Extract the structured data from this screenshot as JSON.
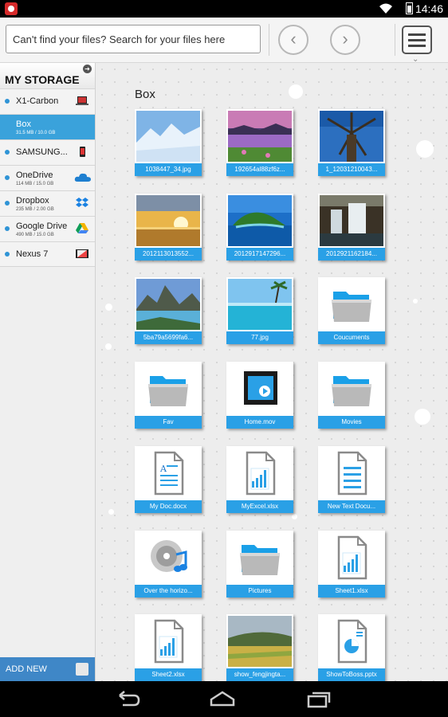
{
  "status": {
    "time": "14:46"
  },
  "search": {
    "placeholder": "Can't find your files? Search for your files here"
  },
  "toolbar": {
    "prev": "‹",
    "next": "›"
  },
  "sidebar": {
    "title": "MY STORAGE",
    "items": [
      {
        "label": "X1-Carbon",
        "sub": "",
        "icon": "laptop-icon"
      },
      {
        "label": "Box",
        "sub": "31.5 MB / 10.0 GB",
        "icon": "",
        "active": true
      },
      {
        "label": "SAMSUNG...",
        "sub": "",
        "icon": "phone-icon"
      },
      {
        "label": "OneDrive",
        "sub": "114 MB / 15.0 GB",
        "icon": "cloud-icon"
      },
      {
        "label": "Dropbox",
        "sub": "235 MB / 2.00 GB",
        "icon": "dropbox-icon"
      },
      {
        "label": "Google Drive",
        "sub": "490 MB / 15.0 GB",
        "icon": "google-drive-icon"
      },
      {
        "label": "Nexus 7",
        "sub": "",
        "icon": "tablet-icon"
      }
    ],
    "add_new": "ADD NEW"
  },
  "breadcrumb": "Box",
  "files": [
    {
      "name": "1038447_34.jpg",
      "kind": "photo-snow-mountain"
    },
    {
      "name": "192654al88zf6z...",
      "kind": "photo-pink-lake"
    },
    {
      "name": "1_1203121004З...",
      "kind": "photo-windmill"
    },
    {
      "name": "2012113013552...",
      "kind": "photo-sunset-sea"
    },
    {
      "name": "2012917147296...",
      "kind": "photo-tropical-island"
    },
    {
      "name": "2012921162184...",
      "kind": "photo-waterfall"
    },
    {
      "name": "5ba79a5699fa6...",
      "kind": "photo-mountain-lake"
    },
    {
      "name": "77.jpg",
      "kind": "photo-beach"
    },
    {
      "name": "Coucuments",
      "kind": "folder"
    },
    {
      "name": "Fav",
      "kind": "folder"
    },
    {
      "name": "Home.mov",
      "kind": "video"
    },
    {
      "name": "Movies",
      "kind": "folder"
    },
    {
      "name": "My Doc.docx",
      "kind": "doc"
    },
    {
      "name": "MyExcel.xlsx",
      "kind": "xls"
    },
    {
      "name": "New Text Docu...",
      "kind": "txt"
    },
    {
      "name": "Over the horizo...",
      "kind": "music"
    },
    {
      "name": "Pictures",
      "kind": "folder"
    },
    {
      "name": "Sheet1.xlsx",
      "kind": "xls"
    },
    {
      "name": "Sheet2.xlsx",
      "kind": "xls"
    },
    {
      "name": "show_fengjingta...",
      "kind": "photo-field"
    },
    {
      "name": "ShowToBoss.pptx",
      "kind": "ppt"
    }
  ],
  "colors": {
    "accent": "#2aa0e6",
    "sidebar_active": "#3aa2db",
    "add_new": "#3f87c7"
  }
}
